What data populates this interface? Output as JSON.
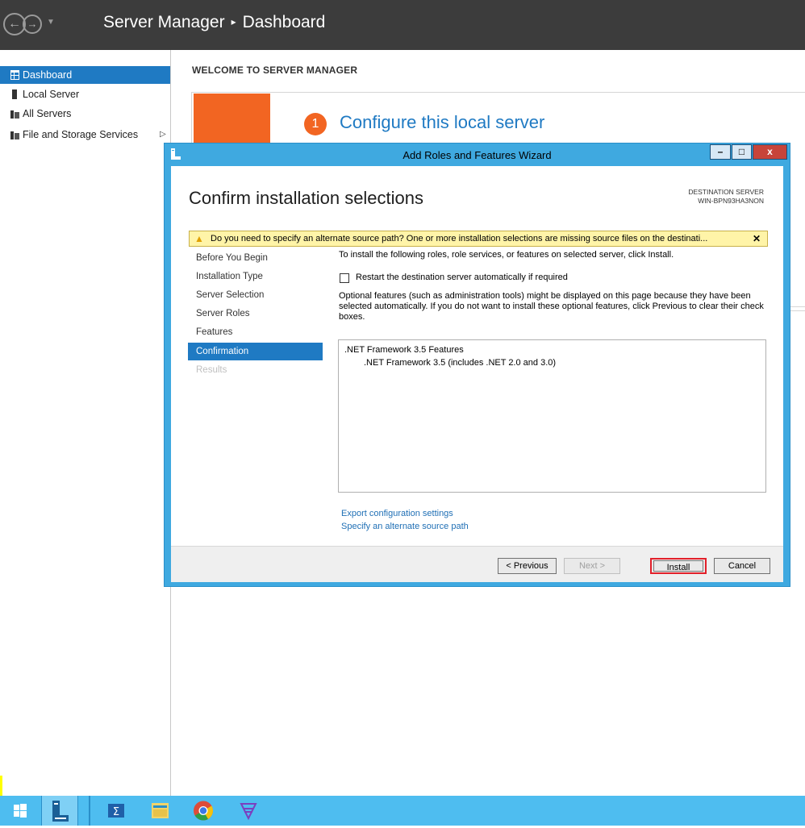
{
  "app": {
    "title": "Server Manager",
    "breadcrumb_sep": "▸",
    "section": "Dashboard"
  },
  "sidebar": {
    "items": [
      {
        "label": "Dashboard",
        "active": true
      },
      {
        "label": "Local Server"
      },
      {
        "label": "All Servers"
      },
      {
        "label": "File and Storage Services",
        "has_arrow": true
      }
    ]
  },
  "main": {
    "welcome_heading": "WELCOME TO SERVER MANAGER",
    "step_number": "1",
    "step_text": "Configure this local server"
  },
  "wizard": {
    "title": "Add Roles and Features Wizard",
    "heading": "Confirm installation selections",
    "destination_label": "DESTINATION SERVER",
    "destination_server": "WIN-BPN93HA3NON",
    "warning": "Do you need to specify an alternate source path? One or more installation selections are missing source files on the destinati...",
    "steps": [
      {
        "label": "Before You Begin"
      },
      {
        "label": "Installation Type"
      },
      {
        "label": "Server Selection"
      },
      {
        "label": "Server Roles"
      },
      {
        "label": "Features"
      },
      {
        "label": "Confirmation",
        "active": true
      },
      {
        "label": "Results",
        "disabled": true
      }
    ],
    "intro": "To install the following roles, role services, or features on selected server, click Install.",
    "restart_label": "Restart the destination server automatically if required",
    "restart_checked": false,
    "optional_text": "Optional features (such as administration tools) might be displayed on this page because they have been selected automatically. If you do not want to install these optional features, click Previous to clear their check boxes.",
    "features": [
      ".NET Framework 3.5 Features",
      ".NET Framework 3.5 (includes .NET 2.0 and 3.0)"
    ],
    "export_link": "Export configuration settings",
    "alt_source_link": "Specify an alternate source path",
    "buttons": {
      "previous": "< Previous",
      "next": "Next >",
      "install": "Install",
      "cancel": "Cancel"
    },
    "window_controls": {
      "minimize": "–",
      "maximize": "□",
      "close": "x"
    }
  },
  "taskbar": {
    "items": [
      "start-icon",
      "server-manager-icon",
      "powershell-icon",
      "file-explorer-icon",
      "chrome-icon",
      "visual-studio-icon"
    ]
  },
  "colors": {
    "accent": "#1f7ac3",
    "orange": "#f26522",
    "taskbar": "#4ebdf0",
    "highlight": "#e2202a"
  }
}
